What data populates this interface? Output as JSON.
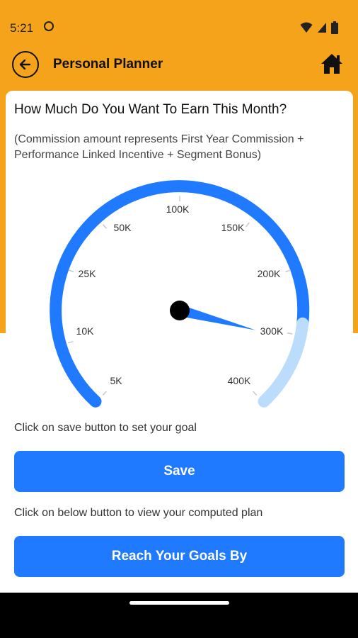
{
  "status_bar": {
    "time": "5:21"
  },
  "app_bar": {
    "title": "Personal Planner",
    "back_icon": "arrow-left-circle-icon",
    "home_icon": "home-icon"
  },
  "card": {
    "question": "How Much Do You Want To Earn This Month?",
    "note": "(Commission amount represents First Year Commission + Performance Linked Incentive + Segment Bonus)"
  },
  "gauge": {
    "labels": [
      "5K",
      "10K",
      "25K",
      "50K",
      "100K",
      "150K",
      "200K",
      "300K",
      "400K"
    ],
    "selected_value": "300K",
    "colors": {
      "filled": "#1F7AFF",
      "unfilled": "#BBDCFB"
    }
  },
  "save_section": {
    "hint": "Click on save button to set your goal",
    "button_label": "Save"
  },
  "plan_section": {
    "hint": "Click on below button to view your computed plan",
    "button_label": "Reach Your Goals By"
  },
  "colors": {
    "app_bar_bg": "#F6A31C",
    "primary": "#1F7AFF"
  }
}
